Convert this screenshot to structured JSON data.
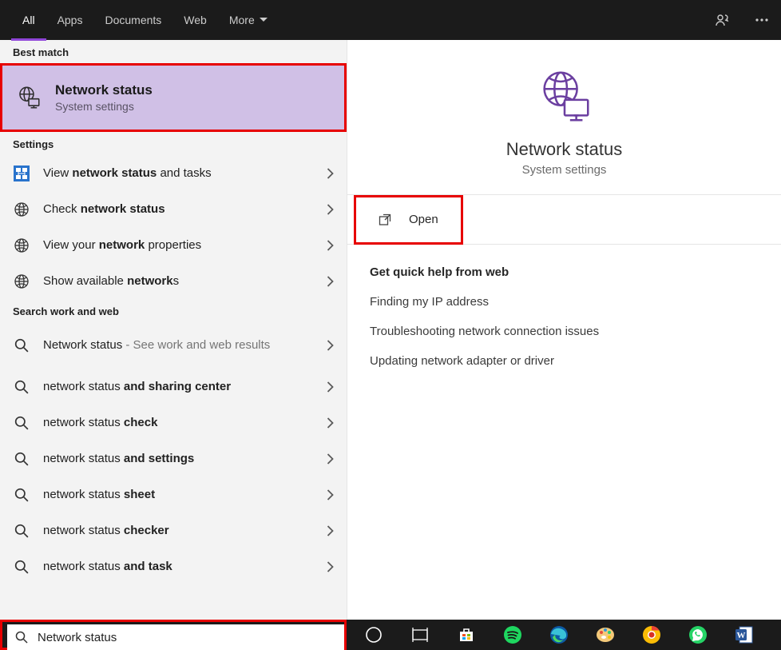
{
  "topbar": {
    "tabs": [
      "All",
      "Apps",
      "Documents",
      "Web",
      "More"
    ],
    "active_index": 0
  },
  "left": {
    "best_match_header": "Best match",
    "best_match": {
      "title": "Network status",
      "subtitle": "System settings"
    },
    "settings_header": "Settings",
    "settings_items": [
      {
        "html": "View <b>network status</b> and tasks",
        "icon": "network-tile"
      },
      {
        "html": "Check <b>network status</b>",
        "icon": "globe"
      },
      {
        "html": "View your <b>network</b> properties",
        "icon": "globe"
      },
      {
        "html": "Show available <b>network</b>s",
        "icon": "globe"
      }
    ],
    "web_header": "Search work and web",
    "web_items": [
      {
        "html": "Network status",
        "hint": " - See work and web results",
        "tall": true
      },
      {
        "html": "network status <b>and sharing center</b>"
      },
      {
        "html": "network status <b>check</b>"
      },
      {
        "html": "network status <b>and settings</b>"
      },
      {
        "html": "network status <b>sheet</b>"
      },
      {
        "html": "network status <b>checker</b>"
      },
      {
        "html": "network status <b>and task</b>"
      }
    ]
  },
  "right": {
    "title": "Network status",
    "subtitle": "System settings",
    "open_label": "Open",
    "quick_header": "Get quick help from web",
    "quick_links": [
      "Finding my IP address",
      "Troubleshooting network connection issues",
      "Updating network adapter or driver"
    ]
  },
  "search_value": "Network status",
  "taskbar_icons": [
    "cortana",
    "task-view",
    "store",
    "spotify",
    "edge",
    "paint",
    "chrome-canary",
    "whatsapp",
    "word"
  ]
}
